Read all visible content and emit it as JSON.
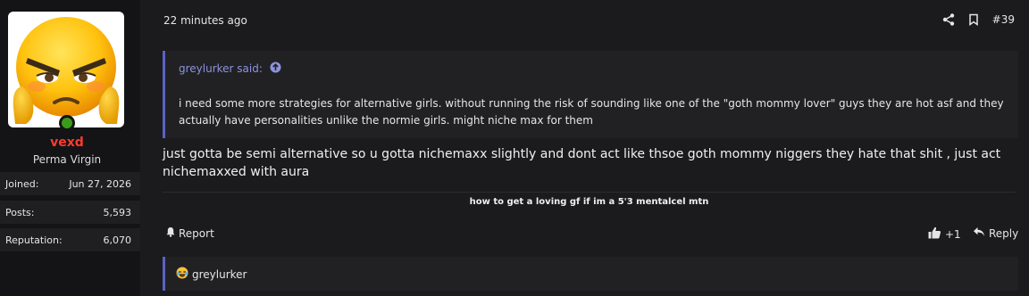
{
  "post": {
    "timestamp": "22 minutes ago",
    "number": "#39",
    "icons": {
      "share": "share-icon",
      "bookmark": "bookmark-icon",
      "report": "bell-icon",
      "like": "thumbs-up-icon",
      "reply": "reply-icon",
      "quote_jump": "arrow-up-circle-icon",
      "reaction": "laughing-emoji-icon"
    }
  },
  "user": {
    "name": "vexd",
    "title": "Perma Virgin",
    "name_color": "#ff3b30",
    "online_color": "#3a9b1b",
    "stats": [
      {
        "label": "Joined:",
        "value": "Jun 27, 2026"
      },
      {
        "label": "Posts:",
        "value": "5,593"
      },
      {
        "label": "Reputation:",
        "value": "6,070"
      }
    ]
  },
  "quote": {
    "author": "greylurker said:",
    "text": "i need some more strategies for alternative girls. without running the risk of sounding like one of the \"goth mommy lover\" guys they are hot asf and they actually have personalities unlike the normie girls. might niche max for them"
  },
  "message": {
    "text": "just gotta be semi alternative so u gotta nichemaxx slightly and dont act like thsoe goth mommy niggers they hate that shit , just act nichemaxxed with aura"
  },
  "signature": "how to get a loving gf if im a 5'3 mentalcel mtn",
  "footer": {
    "report_label": "Report",
    "like_count": "+1",
    "reply_label": "Reply"
  },
  "reactions": {
    "user": "greylurker"
  },
  "colors": {
    "quote_accent": "#5a62c4",
    "quote_author": "#8c93de"
  }
}
